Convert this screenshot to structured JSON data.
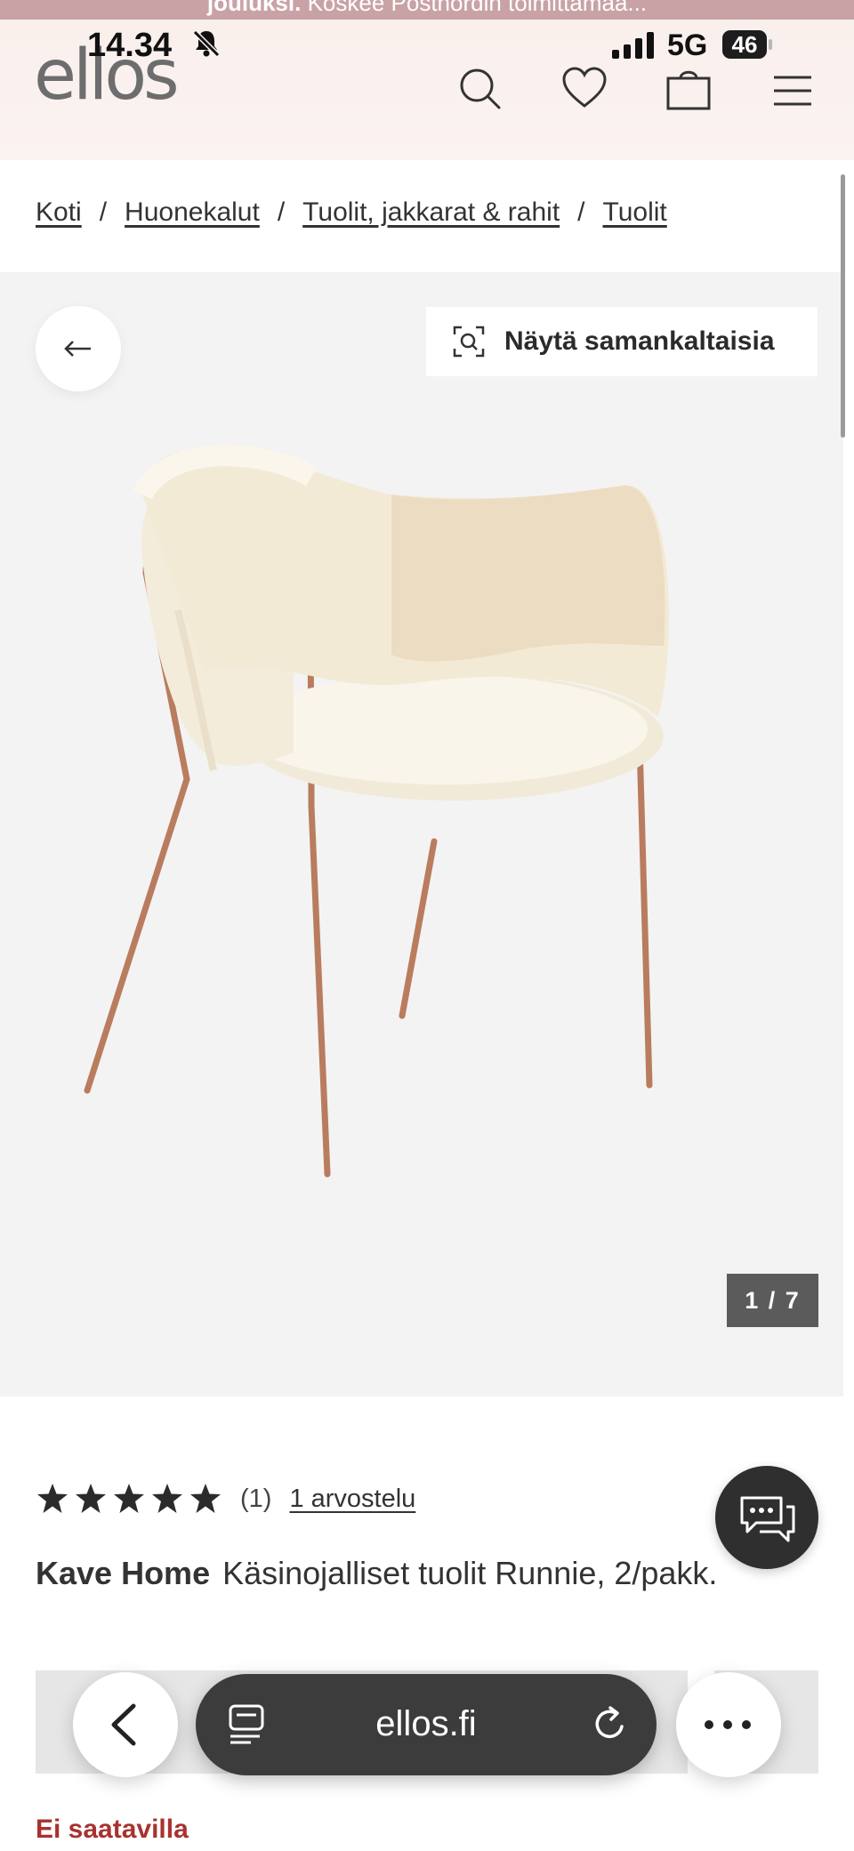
{
  "promo": {
    "bold": "jouluksi.",
    "text": "Koskee Postnordin toimittamaa..."
  },
  "status": {
    "time": "14.34",
    "network": "5G",
    "battery": "46"
  },
  "header": {
    "logo": "ellos"
  },
  "breadcrumb": [
    "Koti",
    "Huonekalut",
    "Tuolit, jakkarat & rahit",
    "Tuolit"
  ],
  "gallery": {
    "similar_label": "Näytä samankaltaisia",
    "counter": "1 / 7"
  },
  "product": {
    "rating_stars": 5,
    "rating_count": "(1)",
    "reviews_link": "1 arvostelu",
    "brand": "Kave Home",
    "name": "Käsinojalliset tuolit Runnie, 2/pakk.",
    "availability": "Ei saatavilla"
  },
  "browser": {
    "url": "ellos.fi"
  },
  "colors": {
    "promo": "#c9a2a6",
    "header": "#f9efec",
    "gallery": "#f4f3f3",
    "unavailable": "#a8322f",
    "pill": "#3c3c3c"
  }
}
